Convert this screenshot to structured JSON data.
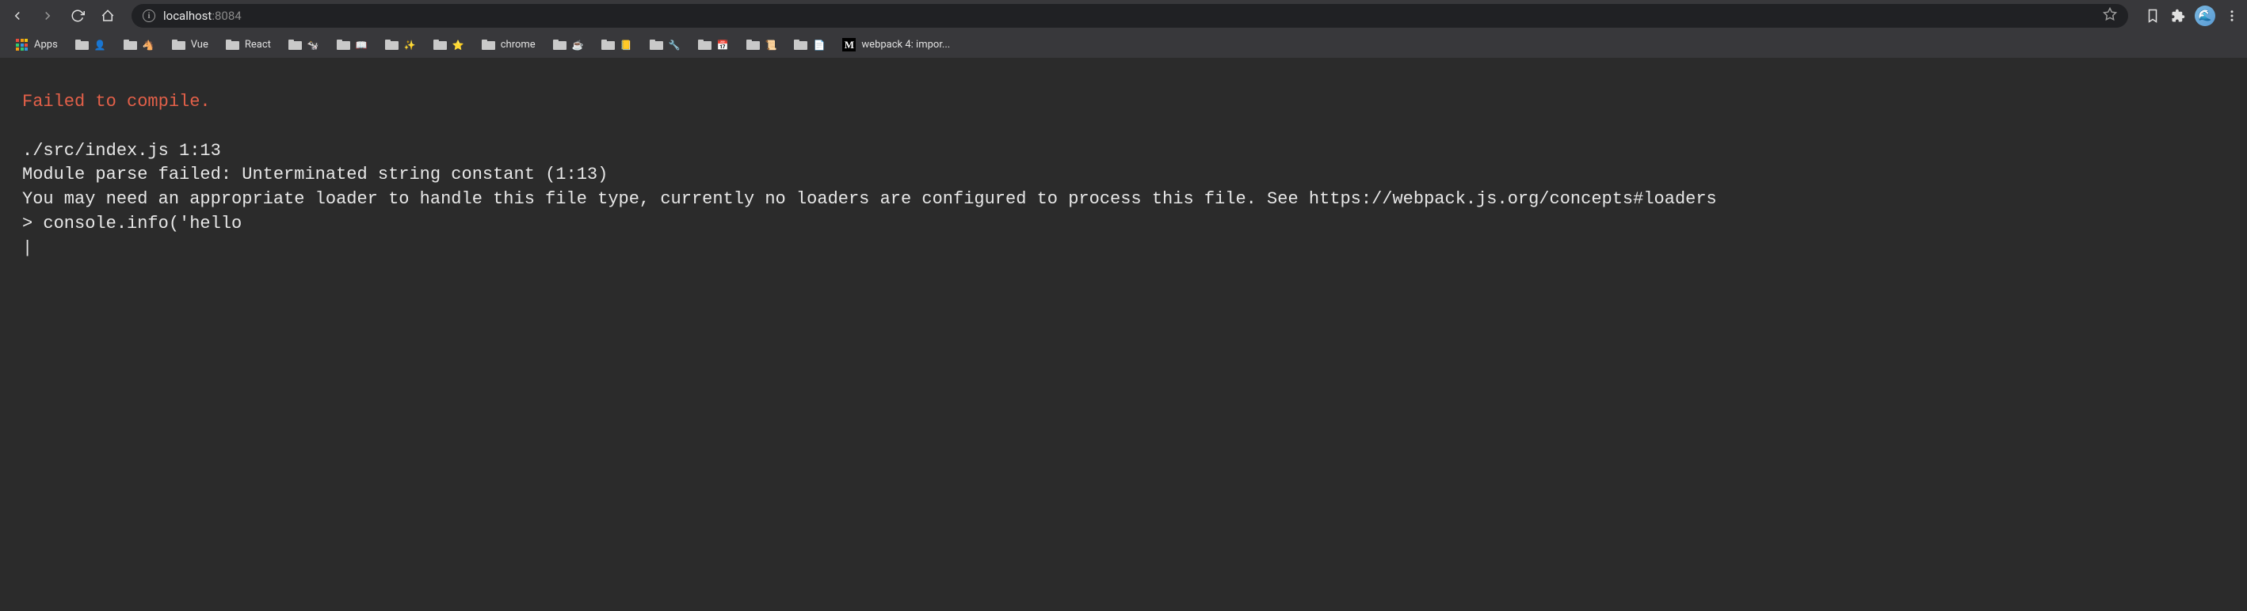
{
  "toolbar": {
    "url_host": "localhost",
    "url_port": ":8084"
  },
  "bookmarks": {
    "apps_label": "Apps",
    "items": [
      {
        "emoji": "👤",
        "label": ""
      },
      {
        "emoji": "🐴",
        "label": ""
      },
      {
        "emoji": "",
        "label": "Vue"
      },
      {
        "emoji": "",
        "label": "React"
      },
      {
        "emoji": "🐄",
        "label": ""
      },
      {
        "emoji": "📖",
        "label": ""
      },
      {
        "emoji": "✨",
        "label": ""
      },
      {
        "emoji": "⭐",
        "label": ""
      },
      {
        "emoji": "",
        "label": "chrome"
      },
      {
        "emoji": "☕",
        "label": ""
      },
      {
        "emoji": "📒",
        "label": ""
      },
      {
        "emoji": "🔧",
        "label": ""
      },
      {
        "emoji": "📅",
        "label": ""
      },
      {
        "emoji": "📜",
        "label": ""
      },
      {
        "emoji": "📄",
        "label": ""
      }
    ],
    "medium_label": "webpack 4: impor..."
  },
  "error": {
    "title": "Failed to compile.",
    "body": "./src/index.js 1:13\nModule parse failed: Unterminated string constant (1:13)\nYou may need an appropriate loader to handle this file type, currently no loaders are configured to process this file. See https://webpack.js.org/concepts#loaders\n> console.info('hello\n| "
  }
}
